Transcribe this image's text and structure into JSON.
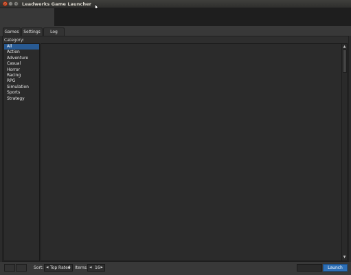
{
  "window": {
    "title": "Leadwerks Game Launcher",
    "close_glyph": "×",
    "min_glyph": "–",
    "max_glyph": "+"
  },
  "tabs": [
    {
      "label": "Games",
      "active": true
    },
    {
      "label": "Settings",
      "active": false
    },
    {
      "label": "Log",
      "active": false
    }
  ],
  "category": {
    "label": "Category:",
    "items": [
      "All",
      "Action",
      "Adventure",
      "Casual",
      "Horror",
      "Racing",
      "RPG",
      "Simulation",
      "Sports",
      "Strategy"
    ],
    "selected": "All"
  },
  "bottom": {
    "sort_label": "Sort:",
    "sort_value": "Top Rated",
    "items_label": "Items:",
    "items_value": "16",
    "left_arrow": "◀",
    "right_arrow": "▶",
    "launch_label": "Launch"
  },
  "scrollbar": {
    "up_glyph": "▲",
    "down_glyph": "▼"
  },
  "colors": {
    "accent": "#2d6fb6",
    "selection": "#285a93",
    "background": "#2b2b2b"
  }
}
